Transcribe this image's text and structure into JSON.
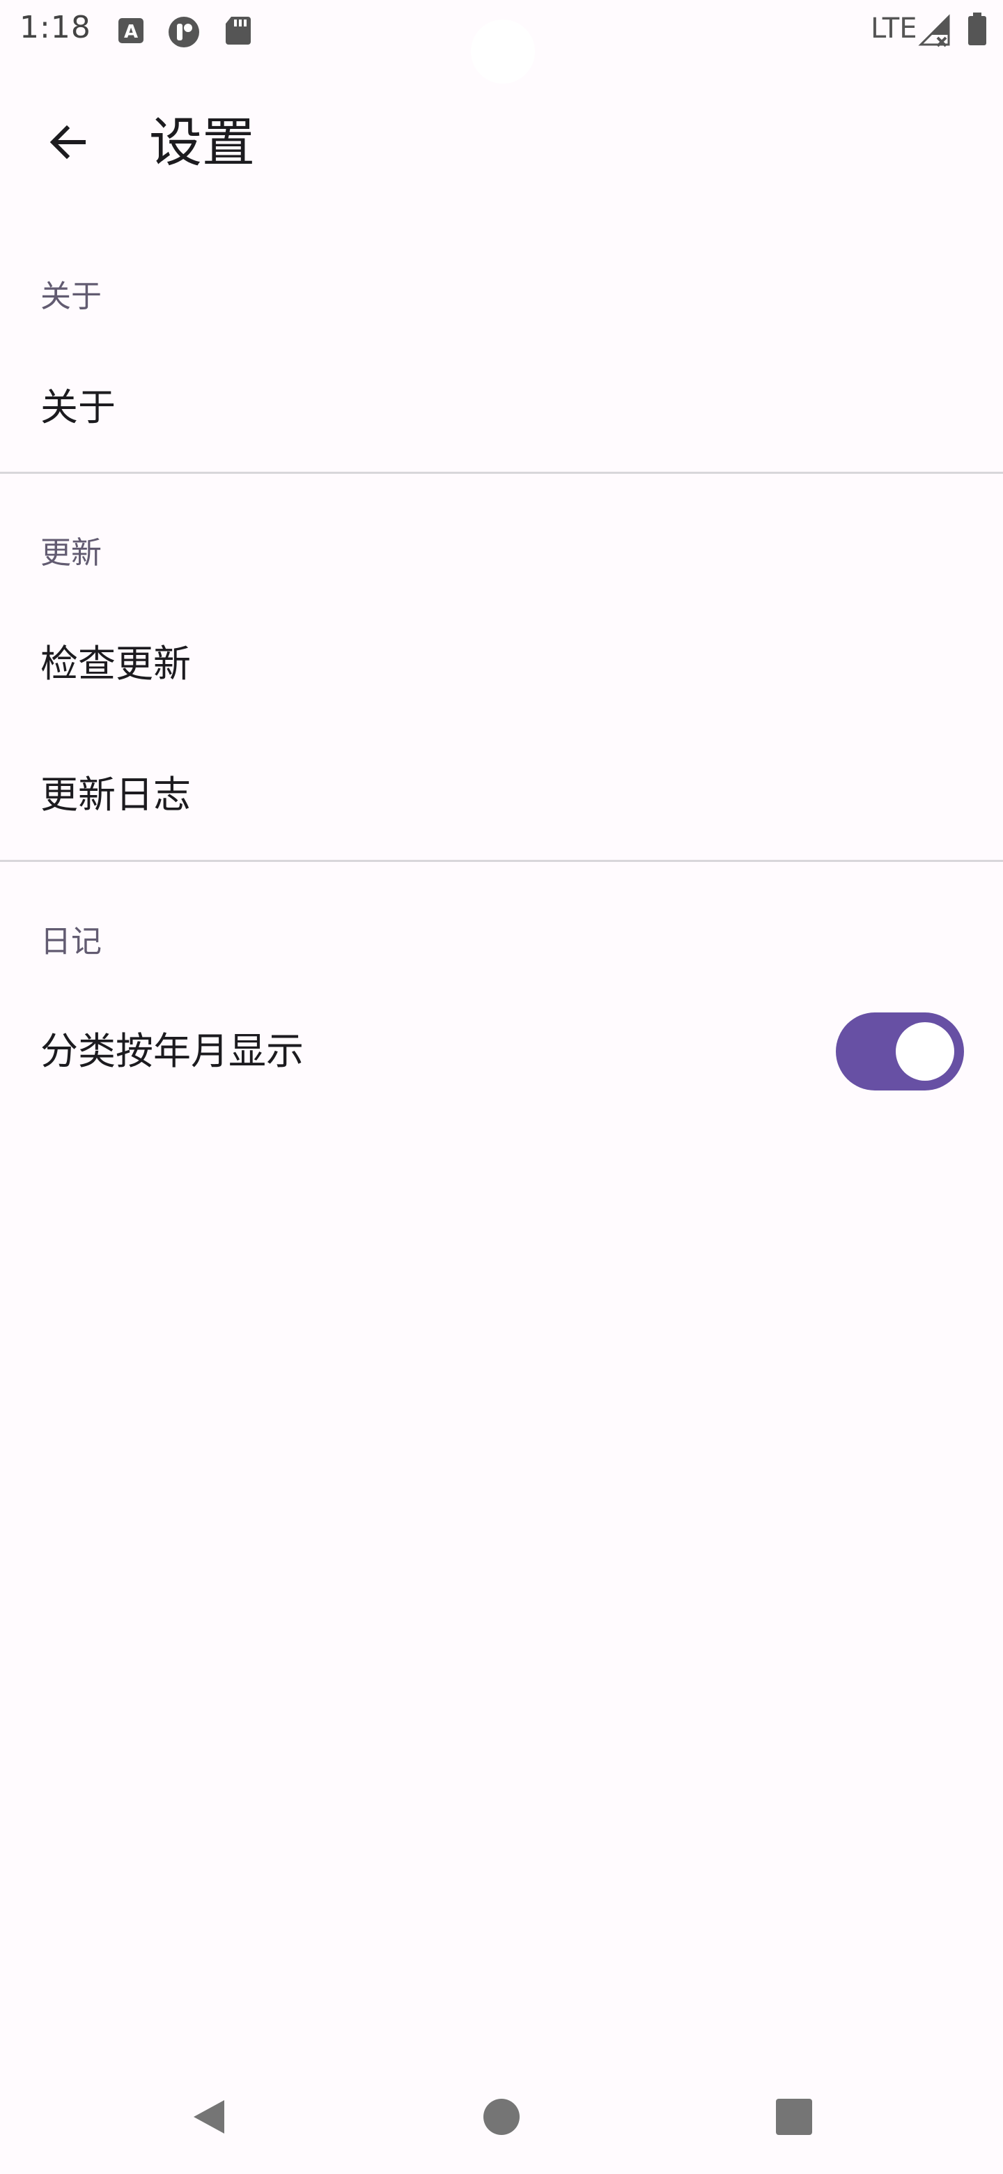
{
  "status_bar": {
    "time": "1:18",
    "network": "LTE",
    "icons": [
      "font-a-icon",
      "app-t-icon",
      "sd-card-icon",
      "signal-no-data-icon",
      "battery-icon"
    ]
  },
  "app_bar": {
    "title": "设置",
    "back_icon": "arrow-left-icon"
  },
  "sections": {
    "about": {
      "header": "关于",
      "items": [
        {
          "title": "关于"
        }
      ]
    },
    "update": {
      "header": "更新",
      "items": [
        {
          "title": "检查更新"
        },
        {
          "title": "更新日志"
        }
      ]
    },
    "diary": {
      "header": "日记",
      "items": [
        {
          "title": "分类按年月显示",
          "switch_on": true
        }
      ]
    }
  },
  "colors": {
    "accent": "#6750a4",
    "background": "#fffbfe",
    "section_header": "#625b71"
  },
  "nav_bar": {
    "buttons": [
      "back-triangle-icon",
      "home-circle-icon",
      "recents-square-icon"
    ]
  }
}
